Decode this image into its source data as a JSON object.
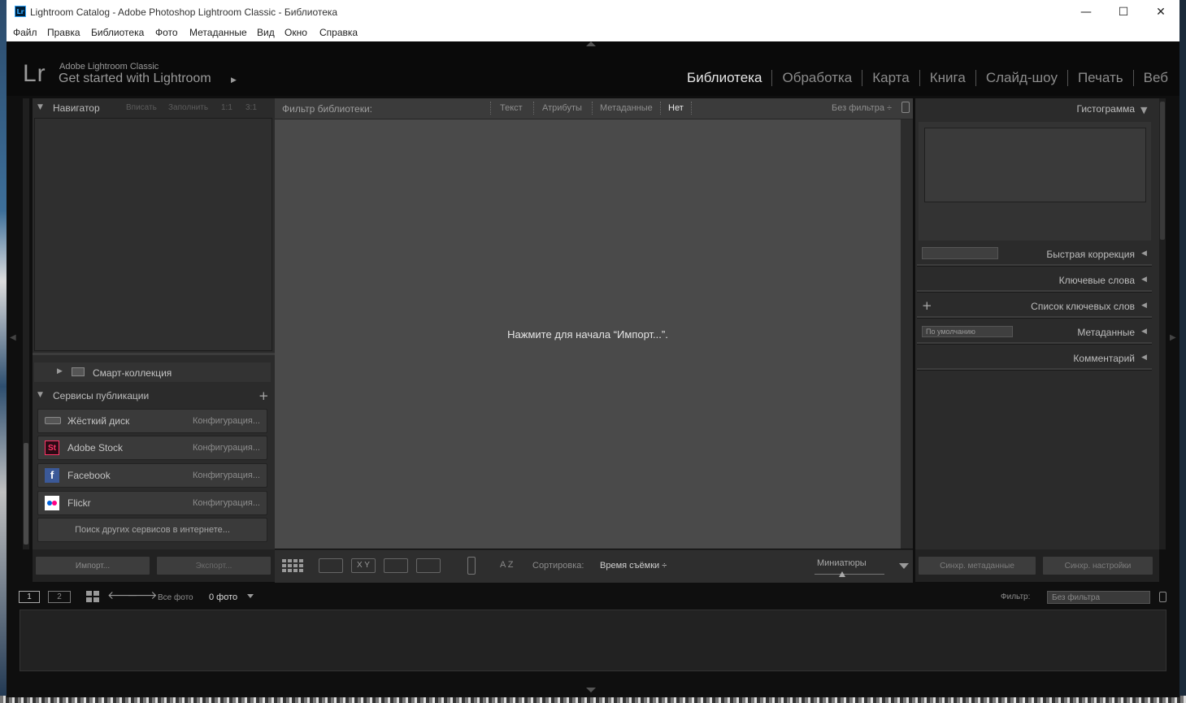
{
  "window": {
    "title": "Lightroom Catalog - Adobe Photoshop Lightroom Classic - Библиотека",
    "app_icon": "Lr",
    "minimize": "—",
    "maximize": "☐",
    "close": "✕"
  },
  "menu": [
    "Файл",
    "Правка",
    "Библиотека",
    "Фото",
    "Метаданные",
    "Вид",
    "Окно",
    "Справка"
  ],
  "identity": {
    "logo": "Lr",
    "brand": "Adobe Lightroom Classic",
    "tagline": "Get started with Lightroom",
    "play_icon": "▶"
  },
  "modules": {
    "items": [
      "Библиотека",
      "Обработка",
      "Карта",
      "Книга",
      "Слайд-шоу",
      "Печать",
      "Веб"
    ],
    "active": "Библиотека"
  },
  "left": {
    "navigator": {
      "title": "Навигатор",
      "options": [
        "Вписать",
        "Заполнить",
        "1:1",
        "3:1"
      ]
    },
    "smart_collection": "Смарт-коллекция",
    "publish": {
      "title": "Сервисы публикации",
      "add": "+",
      "services": [
        {
          "name": "Жёсткий диск",
          "config": "Конфигурация..."
        },
        {
          "name": "Adobe Stock",
          "config": "Конфигурация...",
          "icon": "St"
        },
        {
          "name": "Facebook",
          "config": "Конфигурация...",
          "icon": "f"
        },
        {
          "name": "Flickr",
          "config": "Конфигурация..."
        }
      ],
      "find_more": "Поиск других сервисов в интернете..."
    },
    "import_btn": "Импорт...",
    "export_btn": "Экспорт..."
  },
  "filter": {
    "label": "Фильтр библиотеки:",
    "items": [
      "Текст",
      "Атрибуты",
      "Метаданные",
      "Нет"
    ],
    "active": "Нет",
    "preset": "Без фильтра ÷"
  },
  "grid": {
    "empty_message": "Нажмите для начала “Импорт...”."
  },
  "toolbar": {
    "sort_label": "Сортировка:",
    "sort_value": "Время съёмки ÷",
    "thumbs_label": "Миниатюры",
    "compare_label": "X Y",
    "sort_icon": "A Z",
    "thumb_size_fraction": 0.4
  },
  "right": {
    "histogram": "Гистограмма",
    "quick_develop": "Быстрая коррекция",
    "keywording": "Ключевые слова",
    "keyword_list": "Список ключевых слов",
    "metadata": "Метаданные",
    "metadata_preset": "По умолчанию",
    "comments": "Комментарий",
    "sync_meta": "Синхр. метаданные",
    "sync_settings": "Синхр. настройки",
    "add": "+"
  },
  "filmstrip": {
    "screen1": "1",
    "screen2": "2",
    "source": "Все фото",
    "count": "0 фото",
    "filter_label": "Фильтр:",
    "filter_value": "Без фильтра"
  }
}
